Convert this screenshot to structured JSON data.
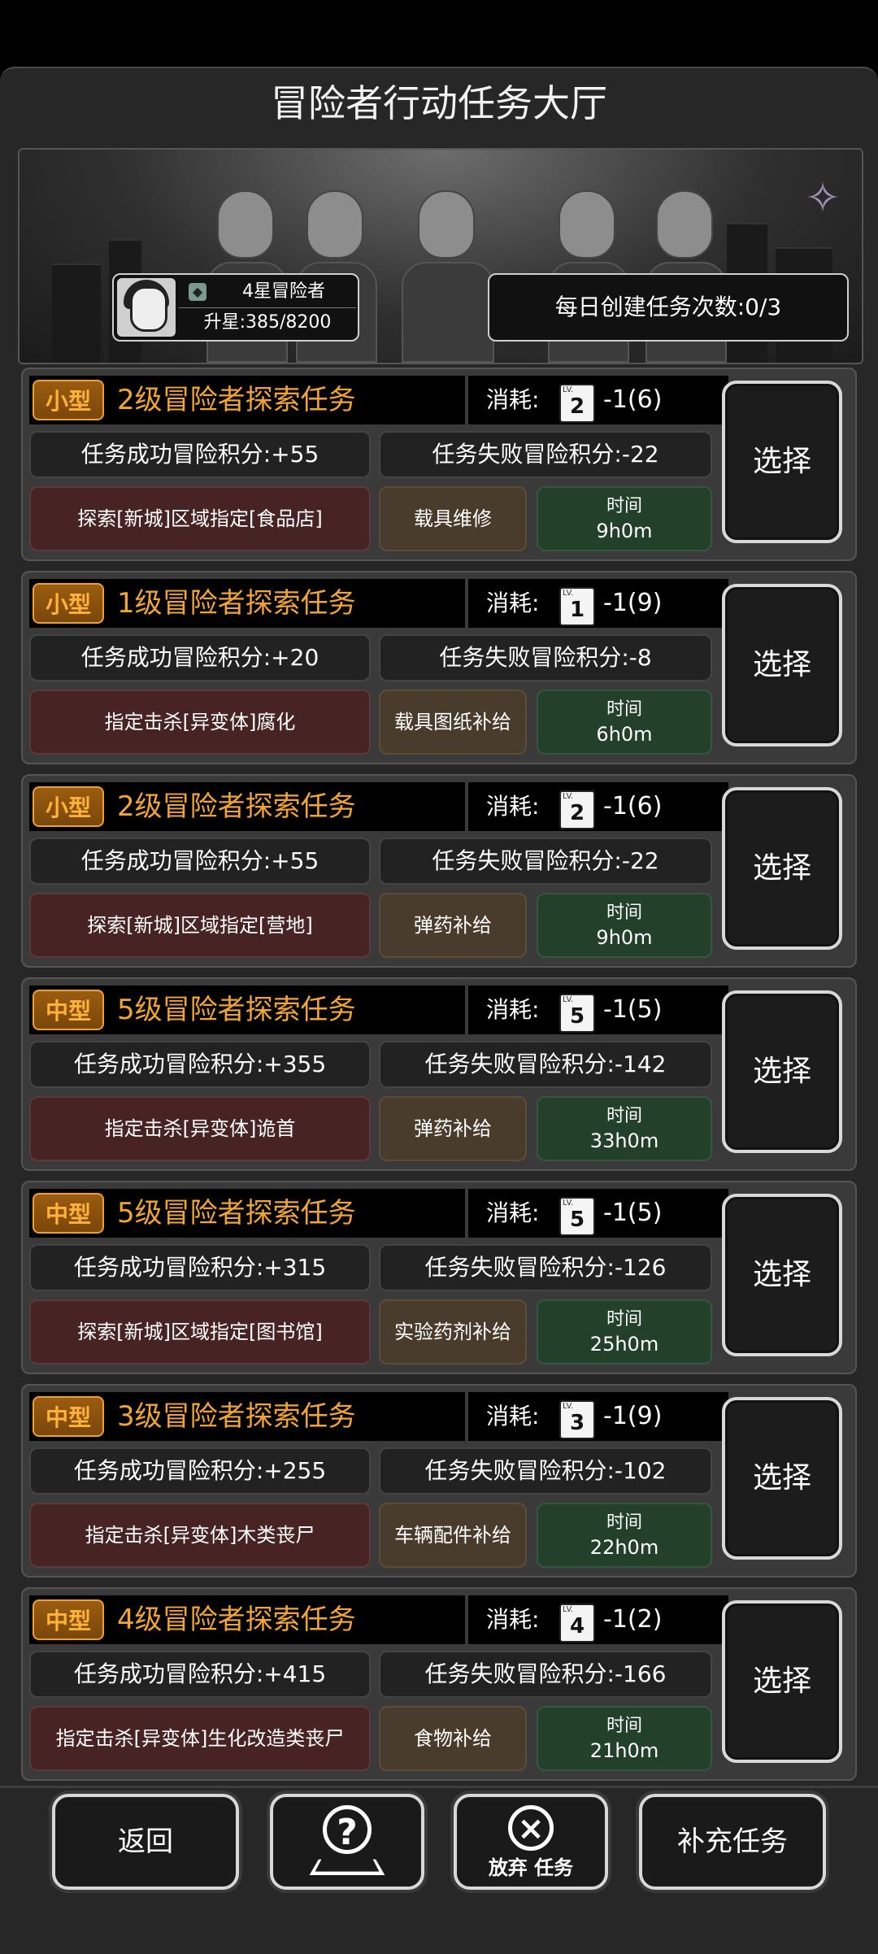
{
  "header": {
    "title": "冒险者行动任务大厅"
  },
  "player": {
    "rank": "4星冒险者",
    "upgrade": "升星:385/8200"
  },
  "daily": {
    "text": "每日创建任务次数:0/3"
  },
  "labels": {
    "cost": "消耗:",
    "time": "时间",
    "lv": "LV.",
    "select": "选择"
  },
  "tasks": [
    {
      "size": "小型",
      "name": "2级冒险者探索任务",
      "lv": "2",
      "cost": "-1(6)",
      "success": "任务成功冒险积分:+55",
      "fail": "任务失败冒险积分:-22",
      "objective": "探索[新城]区域指定[食品店]",
      "reward": "载具维修",
      "time": "9h0m"
    },
    {
      "size": "小型",
      "name": "1级冒险者探索任务",
      "lv": "1",
      "cost": "-1(9)",
      "success": "任务成功冒险积分:+20",
      "fail": "任务失败冒险积分:-8",
      "objective": "指定击杀[异变体]腐化",
      "reward": "载具图纸补给",
      "time": "6h0m"
    },
    {
      "size": "小型",
      "name": "2级冒险者探索任务",
      "lv": "2",
      "cost": "-1(6)",
      "success": "任务成功冒险积分:+55",
      "fail": "任务失败冒险积分:-22",
      "objective": "探索[新城]区域指定[营地]",
      "reward": "弹药补给",
      "time": "9h0m"
    },
    {
      "size": "中型",
      "name": "5级冒险者探索任务",
      "lv": "5",
      "cost": "-1(5)",
      "success": "任务成功冒险积分:+355",
      "fail": "任务失败冒险积分:-142",
      "objective": "指定击杀[异变体]诡首",
      "reward": "弹药补给",
      "time": "33h0m"
    },
    {
      "size": "中型",
      "name": "5级冒险者探索任务",
      "lv": "5",
      "cost": "-1(5)",
      "success": "任务成功冒险积分:+315",
      "fail": "任务失败冒险积分:-126",
      "objective": "探索[新城]区域指定[图书馆]",
      "reward": "实验药剂补给",
      "time": "25h0m"
    },
    {
      "size": "中型",
      "name": "3级冒险者探索任务",
      "lv": "3",
      "cost": "-1(9)",
      "success": "任务成功冒险积分:+255",
      "fail": "任务失败冒险积分:-102",
      "objective": "指定击杀[异变体]木类丧尸",
      "reward": "车辆配件补给",
      "time": "22h0m"
    },
    {
      "size": "中型",
      "name": "4级冒险者探索任务",
      "lv": "4",
      "cost": "-1(2)",
      "success": "任务成功冒险积分:+415",
      "fail": "任务失败冒险积分:-166",
      "objective": "指定击杀[异变体]生化改造类丧尸",
      "reward": "食物补给",
      "time": "21h0m"
    }
  ],
  "bottom": {
    "back": "返回",
    "abandon": "放弃 任务",
    "refill": "补充任务"
  }
}
